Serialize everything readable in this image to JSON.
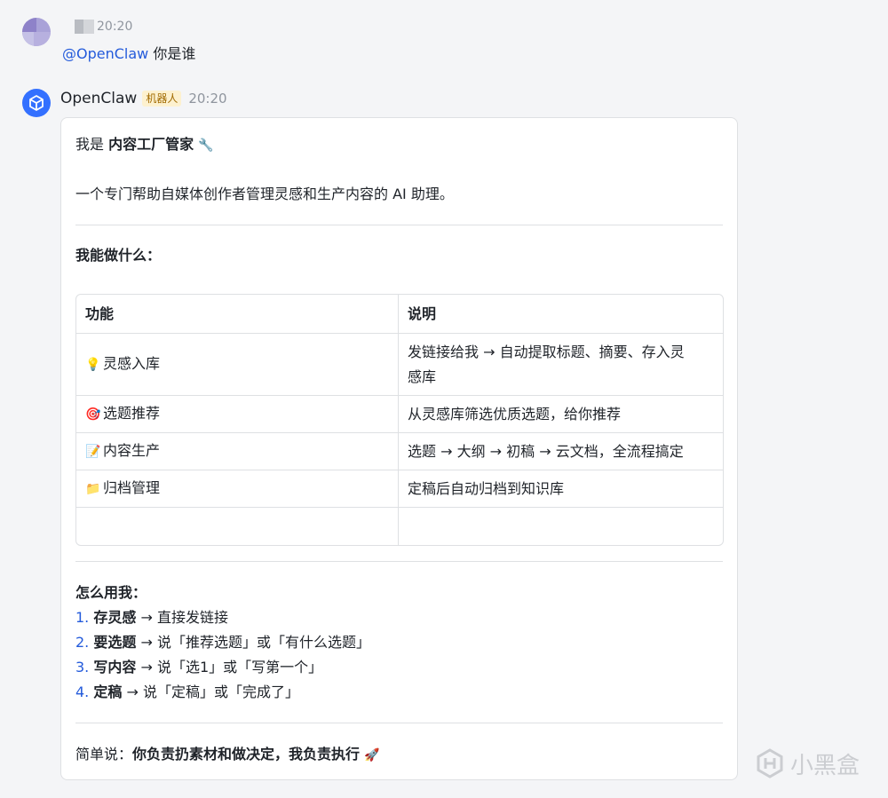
{
  "user_message": {
    "time": "20:20",
    "mention": "@OpenClaw",
    "text": "你是谁"
  },
  "bot_message": {
    "name": "OpenClaw",
    "badge": "机器人",
    "time": "20:20",
    "intro_prefix": "我是 ",
    "intro_bold": "内容工厂管家",
    "intro_emoji": "🔧",
    "description": "一个专门帮助自媒体创作者管理灵感和生产内容的 AI 助理。",
    "capabilities_title": "我能做什么：",
    "table": {
      "headers": [
        "功能",
        "说明"
      ],
      "rows": [
        {
          "emoji": "💡",
          "feature": "灵感入库",
          "desc_line1": "发链接给我 → 自动提取标题、摘要、存入灵",
          "desc_line2": "感库"
        },
        {
          "emoji": "🎯",
          "feature": "选题推荐",
          "desc_line1": "从灵感库筛选优质选题，给你推荐",
          "desc_line2": ""
        },
        {
          "emoji": "📝",
          "feature": "内容生产",
          "desc_line1": "选题 → 大纲 → 初稿 → 云文档，全流程搞定",
          "desc_line2": ""
        },
        {
          "emoji": "📁",
          "feature": "归档管理",
          "desc_line1": "定稿后自动归档到知识库",
          "desc_line2": ""
        }
      ]
    },
    "howto_title": "怎么用我：",
    "steps": [
      {
        "num": "1.",
        "action": "存灵感",
        "text": " → 直接发链接"
      },
      {
        "num": "2.",
        "action": "要选题",
        "text": " → 说「推荐选题」或「有什么选题」"
      },
      {
        "num": "3.",
        "action": "写内容",
        "text": " → 说「选1」或「写第一个」"
      },
      {
        "num": "4.",
        "action": "定稿",
        "text": " → 说「定稿」或「完成了」"
      }
    ],
    "summary_prefix": "简单说：",
    "summary_bold": "你负责扔素材和做决定，我负责执行",
    "summary_emoji": "🚀"
  },
  "watermark": "小黑盒",
  "colors": {
    "link": "#245bdb",
    "bot_avatar": "#3370ff",
    "badge_bg": "#fdf1cf",
    "badge_text": "#a16a00"
  }
}
